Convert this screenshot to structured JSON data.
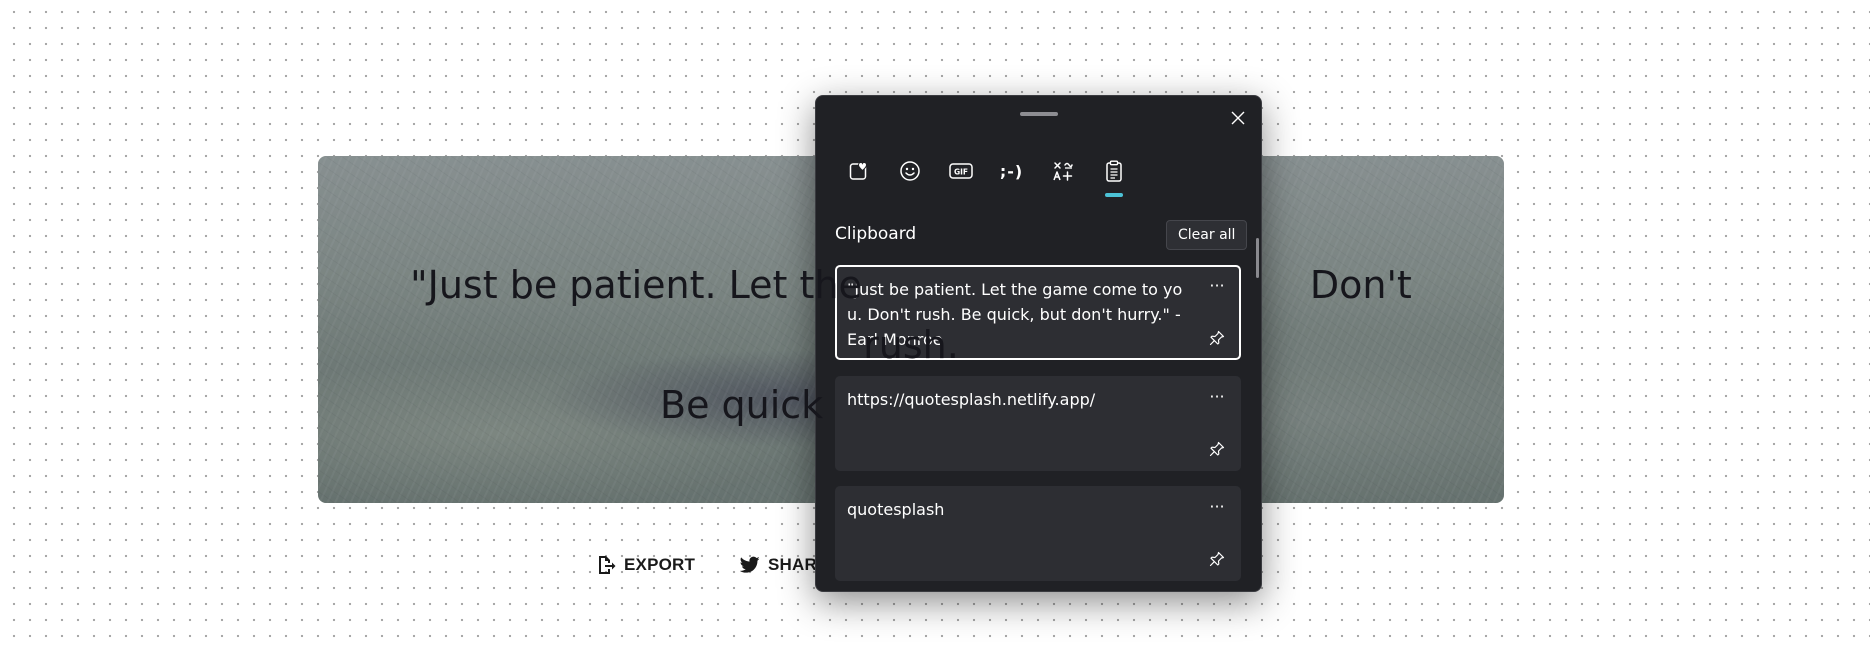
{
  "quote_card": {
    "quote_lines_visible": "\"Just be patient. Let the",
    "quote_line_right": "Don't rush.",
    "quote_line_2": "Be quick"
  },
  "actions": {
    "export_label": "EXPORT",
    "share_label": "SHARE"
  },
  "clipboard_panel": {
    "tabs": [
      {
        "icon": "favorites-heart-icon",
        "active": false
      },
      {
        "icon": "emoji-icon",
        "active": false
      },
      {
        "icon": "gif-icon",
        "glyph": "GIF",
        "active": false
      },
      {
        "icon": "kaomoji-icon",
        "glyph": ";-)",
        "active": false
      },
      {
        "icon": "symbols-icon",
        "active": false
      },
      {
        "icon": "clipboard-icon",
        "active": true
      }
    ],
    "section_title": "Clipboard",
    "clear_all_label": "Clear all",
    "more_label": "···",
    "items": [
      {
        "text": "\"Just be patient. Let the game come to you. Don't rush. Be quick, but don't hurry.\" - Earl Monroe",
        "selected": true
      },
      {
        "text": "https://quotesplash.netlify.app/",
        "selected": false
      },
      {
        "text": "quotesplash",
        "selected": false
      }
    ]
  },
  "colors": {
    "panel_bg": "#202125",
    "item_bg": "#2d2e33",
    "accent": "#4cc2d6"
  }
}
